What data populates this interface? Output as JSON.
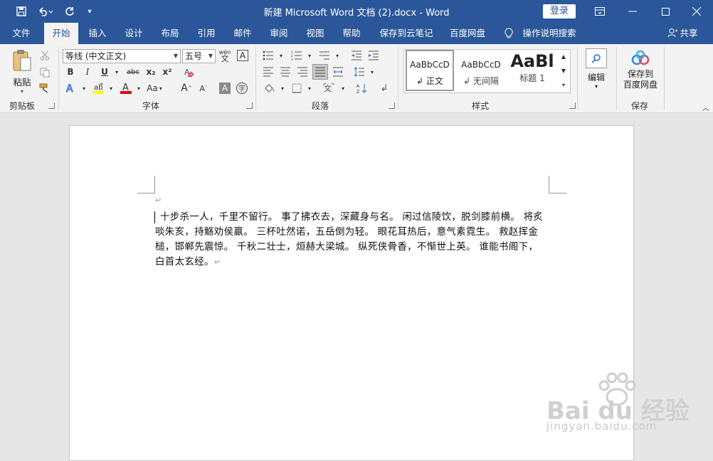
{
  "window": {
    "title": "新建 Microsoft Word 文档 (2).docx  -  Word",
    "login": "登录"
  },
  "tabs": [
    {
      "label": "文件"
    },
    {
      "label": "开始"
    },
    {
      "label": "插入"
    },
    {
      "label": "设计"
    },
    {
      "label": "布局"
    },
    {
      "label": "引用"
    },
    {
      "label": "邮件"
    },
    {
      "label": "审阅"
    },
    {
      "label": "视图"
    },
    {
      "label": "帮助"
    },
    {
      "label": "保存到云笔记"
    },
    {
      "label": "百度网盘"
    },
    {
      "label": "操作说明搜索"
    }
  ],
  "share": "共享",
  "clipboard": {
    "paste": "粘贴",
    "label": "剪贴板"
  },
  "font": {
    "name": "等线 (中文正文)",
    "size": "五号",
    "label": "字体",
    "bold": "B",
    "italic": "I",
    "underline": "U",
    "strike": "abc",
    "subscript": "x₂",
    "superscript": "x²",
    "case": "Aa",
    "grow": "A",
    "shrink": "A",
    "phonetic": "wén",
    "border_char": "A",
    "enclose": "字"
  },
  "paragraph": {
    "label": "段落"
  },
  "styles": {
    "label": "样式",
    "items": [
      {
        "preview": "AaBbCcD",
        "name": "正文"
      },
      {
        "preview": "AaBbCcD",
        "name": "无间隔"
      },
      {
        "preview": "AaBl",
        "name": "标题 1"
      }
    ]
  },
  "editing": {
    "label": "编辑"
  },
  "save_group": {
    "button": "保存到\n百度网盘",
    "label": "保存",
    "button_line1": "保存到",
    "button_line2": "百度网盘"
  },
  "document": {
    "lines": [
      "十步杀一人，千里不留行。 事了拂衣去，深藏身与名。 闲过信陵饮，脱剑膝前横。 将炙",
      "啖朱亥，持觞劝侯嬴。 三杯吐然诺，五岳倒为轻。 眼花耳热后，意气素霓生。 救赵挥金",
      "槌，邯郸先震惊。 千秋二壮士，烜赫大梁城。 纵死侠骨香，不惭世上英。 谁能书阁下，",
      "白首太玄经。"
    ],
    "paragraph_mark": "↵"
  },
  "watermark": {
    "brand": "Bai du 经验",
    "url": "jingyan.baidu.com"
  },
  "colors": {
    "accent": "#2b579a",
    "highlight": "#ffff00",
    "font_color": "#e00000"
  }
}
